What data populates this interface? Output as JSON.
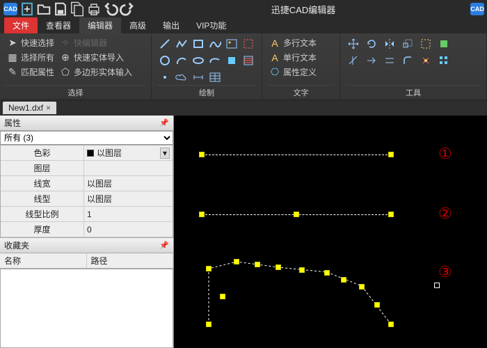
{
  "title": "迅捷CAD编辑器",
  "titlebar_icons": [
    "cad",
    "new",
    "open",
    "save",
    "saveall",
    "print",
    "undo",
    "redo"
  ],
  "menu": {
    "file": "文件",
    "viewer": "查看器",
    "editor": "编辑器",
    "advanced": "高级",
    "output": "输出",
    "vip": "VIP功能"
  },
  "ribbon": {
    "select": {
      "label": "选择",
      "quick_select": "快速选择",
      "quick_editor": "快编辑器",
      "select_all": "选择所有",
      "quick_import": "快速实体导入",
      "match_props": "匹配属性",
      "poly_input": "多边形实体输入"
    },
    "draw": {
      "label": "绘制"
    },
    "text": {
      "label": "文字",
      "mtext": "多行文本",
      "stext": "单行文本",
      "attdef": "属性定义"
    },
    "tools": {
      "label": "工具"
    }
  },
  "doc_tab": "New1.dxf",
  "panel": {
    "props_title": "属性",
    "filter": "所有 (3)",
    "rows": {
      "color": {
        "k": "色彩",
        "v": "以图层"
      },
      "layer": {
        "k": "图层",
        "v": ""
      },
      "lw": {
        "k": "线宽",
        "v": "以图层"
      },
      "lt": {
        "k": "线型",
        "v": "以图层"
      },
      "ltscale": {
        "k": "线型比例",
        "v": "1"
      },
      "thick": {
        "k": "厚度",
        "v": "0"
      }
    },
    "fav_title": "收藏夹",
    "fav_cols": {
      "name": "名称",
      "path": "路径"
    }
  },
  "annot": {
    "n1": "①",
    "n2": "②",
    "n3": "③"
  }
}
